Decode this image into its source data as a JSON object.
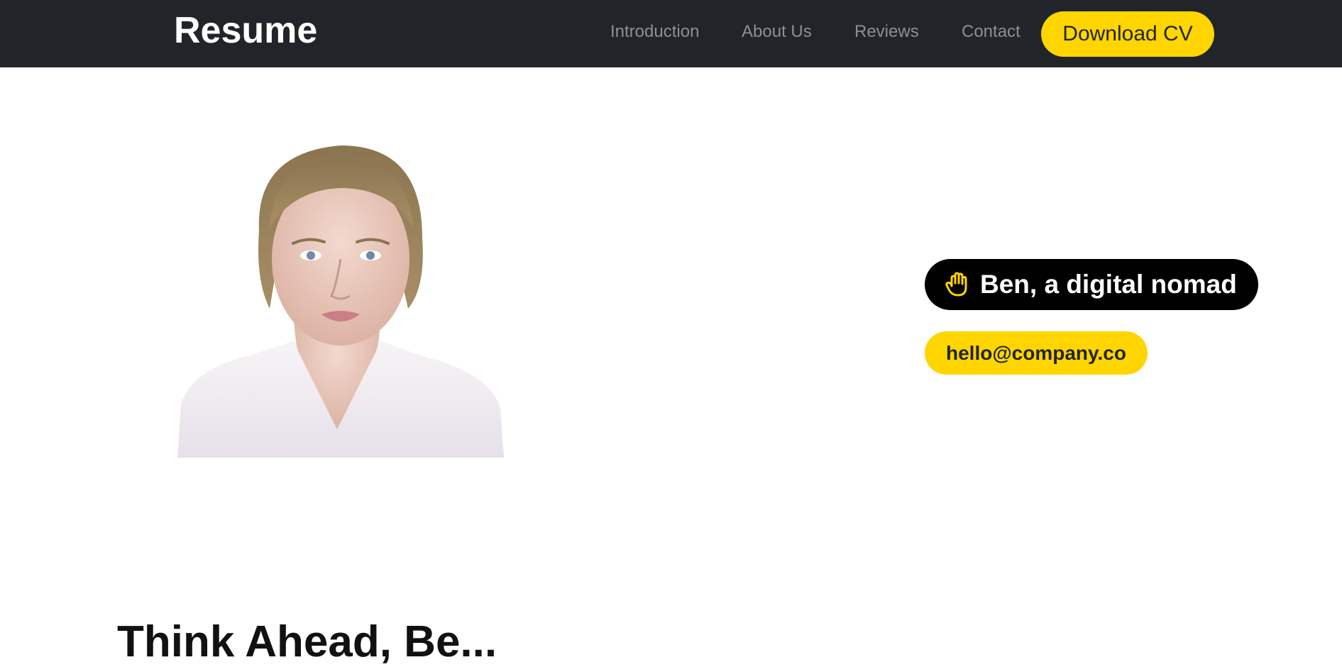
{
  "navbar": {
    "brand": "Resume",
    "links": [
      "Introduction",
      "About Us",
      "Reviews",
      "Contact"
    ],
    "cta_label": "Download CV",
    "background": "#212529",
    "accent": "#ffd500"
  },
  "hero": {
    "portrait_alt": "portrait",
    "tagline": "Ben, a digital nomad",
    "tagline_icon": "waving-hand-icon",
    "email": "hello@company.co"
  },
  "next_section": {
    "heading": "Think Ahead, Be..."
  }
}
